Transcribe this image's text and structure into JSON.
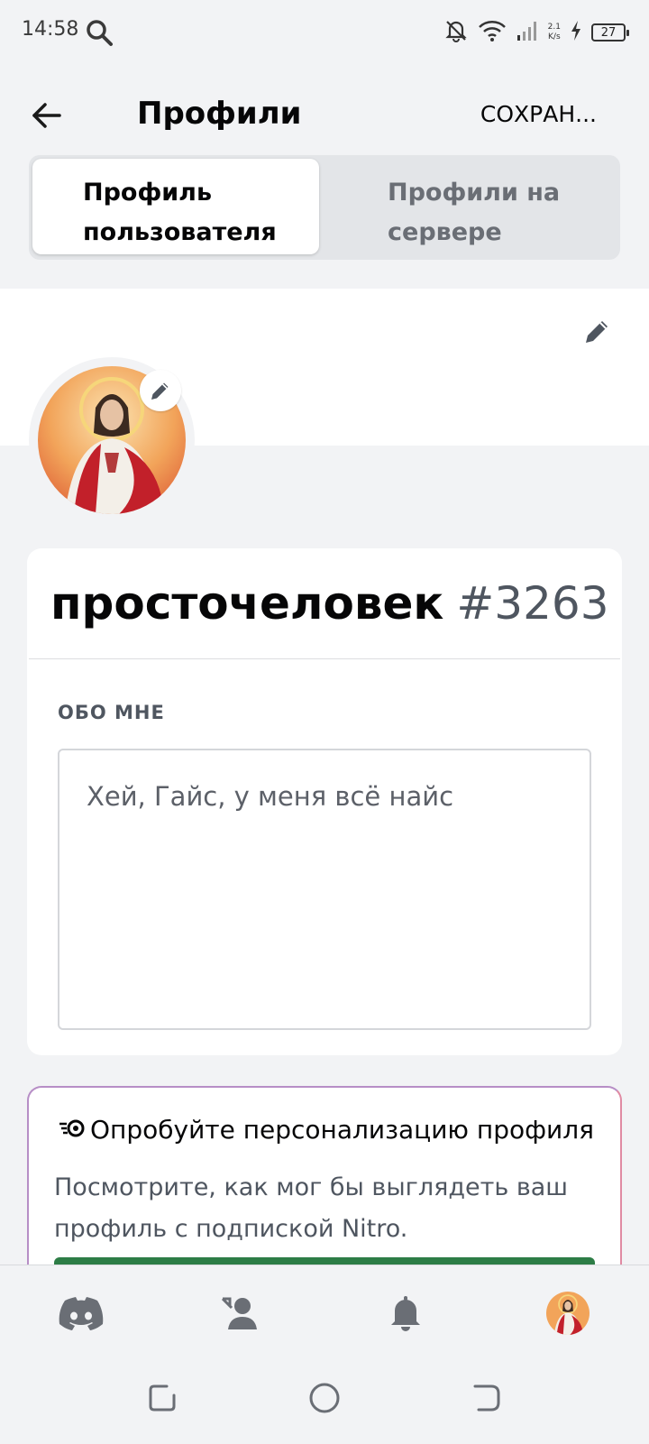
{
  "status_bar": {
    "time": "14:58",
    "net_speed_value": "2.1",
    "net_speed_unit": "K/s",
    "battery": "27"
  },
  "header": {
    "title": "Профили",
    "save_label": "СОХРАН..."
  },
  "tabs": [
    {
      "label": "Профиль пользователя",
      "active": true
    },
    {
      "label": "Профили на сервере",
      "active": false
    }
  ],
  "profile": {
    "username": "просточеловек",
    "discriminator": "#3263",
    "about_label": "ОБО МНЕ",
    "about_text": "Хей, Гайс, у меня всё найс"
  },
  "nitro_promo": {
    "title": "Опробуйте персонализацию профиля",
    "description": "Посмотрите, как мог бы выглядеть ваш профиль с подпиской Nitro.",
    "button_color": "#2d7d46"
  },
  "bottom_nav": {
    "items": [
      "discord-home-icon",
      "friends-icon",
      "bell-icon",
      "profile-avatar"
    ]
  },
  "colors": {
    "background": "#f2f3f5",
    "card": "#ffffff",
    "muted_text": "#4f5660",
    "promo_border": "#b78ec6"
  }
}
